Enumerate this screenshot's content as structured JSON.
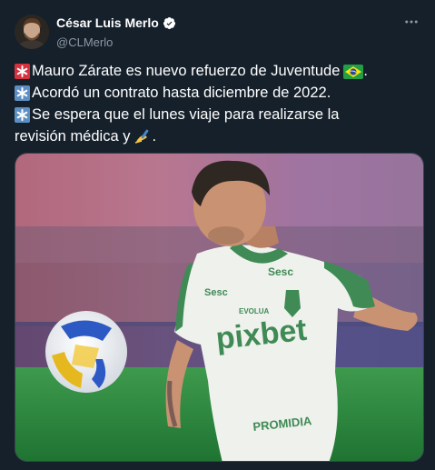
{
  "author": {
    "display_name": "César Luis Merlo",
    "handle": "@CLMerlo",
    "verified": true
  },
  "icons": {
    "verified": "verified-badge-icon",
    "more": "more-options-icon",
    "bullet_red": "red-asterisk-emoji",
    "bullet_blue": "blue-asterisk-emoji",
    "flag": "brazil-flag-emoji",
    "writing": "writing-hand-emoji"
  },
  "tweet": {
    "line1": "Mauro Zárate es nuevo refuerzo de Juventude",
    "line1_end": ".",
    "line2": "Acordó un contrato hasta diciembre de 2022.",
    "line3": "Se espera que el lunes viaje para realizarse la",
    "line4": "revisión médica y",
    "line4_end": "."
  },
  "photo": {
    "jersey_sponsor": "pixbet",
    "jersey_brand": "Sesc",
    "jersey_sleeve": "Sesc",
    "jersey_small": "EVOLUA",
    "jersey_bottom": "PROMIDIA"
  },
  "colors": {
    "background": "#15202b",
    "text": "#ffffff",
    "secondary": "#8b98a5",
    "verified": "#ffffff",
    "jersey_green": "#3f8a55"
  }
}
